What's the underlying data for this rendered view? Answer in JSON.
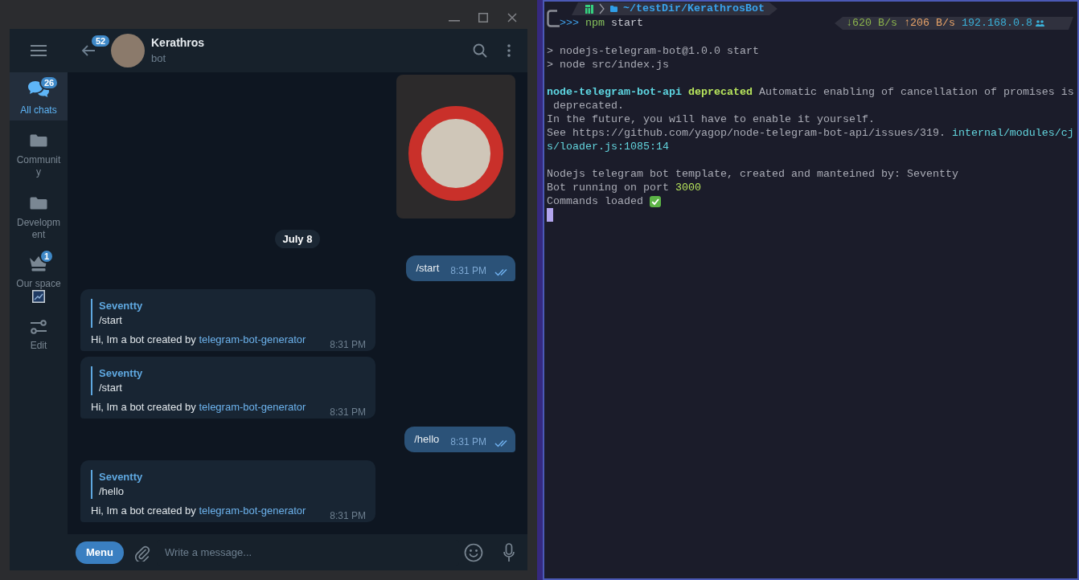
{
  "sidebar": {
    "items": [
      {
        "kind": "chats",
        "label": "All chats",
        "badge": "26",
        "selected": true
      },
      {
        "kind": "folder",
        "label": "Community",
        "selected": false
      },
      {
        "kind": "folder",
        "label": "Development",
        "selected": false
      },
      {
        "kind": "crown",
        "label": "Our space",
        "badge": "1",
        "selected": false
      },
      {
        "kind": "image",
        "selected": false
      },
      {
        "kind": "edit",
        "label": "Edit",
        "selected": false
      }
    ]
  },
  "header": {
    "title": "Kerathros",
    "subtitle": "bot",
    "unread_badge": "52"
  },
  "messages": [
    {
      "kind": "photo"
    },
    {
      "kind": "date",
      "text": "July 8"
    },
    {
      "kind": "outgoing",
      "text": "/start",
      "time": "8:31 PM",
      "read": true
    },
    {
      "kind": "incoming",
      "reply_author": "Seventty",
      "reply_text": "/start",
      "text": "Hi, Im a bot created by ",
      "link": "telegram-bot-generator",
      "time": "8:31 PM"
    },
    {
      "kind": "incoming",
      "reply_author": "Seventty",
      "reply_text": "/start",
      "text": "Hi, Im a bot created by ",
      "link": "telegram-bot-generator",
      "time": "8:31 PM"
    },
    {
      "kind": "outgoing",
      "text": "/hello",
      "time": "8:31 PM",
      "read": true
    },
    {
      "kind": "incoming",
      "reply_author": "Seventty",
      "reply_text": "/hello",
      "text": "Hi, Im a bot created by ",
      "link": "telegram-bot-generator",
      "time": "8:31 PM"
    }
  ],
  "composer": {
    "menu_button": "Menu",
    "placeholder": "Write a message..."
  },
  "terminal": {
    "prompt": {
      "path": "~/testDir/KerathrosBot",
      "arrows": ">>>",
      "command": "npm",
      "argument": "start"
    },
    "status": {
      "download": "↓620 B/s",
      "upload": "↑206 B/s",
      "ip": "192.168.0.8"
    },
    "output": [
      [
        [
          {
            "kind": "plain",
            "text": "> nodejs-telegram-bot@1.0.0 start"
          }
        ],
        [
          {
            "kind": "plain",
            "text": "> node src/index.js"
          }
        ]
      ],
      [
        [
          {
            "kind": "module",
            "text": "node-telegram-bot-api "
          },
          {
            "kind": "warning",
            "text": "deprecated"
          },
          {
            "kind": "plain",
            "text": " Automatic enabling of cancellation of promises is"
          }
        ],
        [
          {
            "kind": "plain",
            "text": " deprecated."
          }
        ],
        [
          {
            "kind": "plain",
            "text": "In the future, you will have to enable it yourself."
          }
        ],
        [
          {
            "kind": "plain",
            "text": "See https://github.com/yagop/node-telegram-bot-api/issues/319. "
          },
          {
            "kind": "path",
            "text": "internal/modules/cj"
          }
        ],
        [
          {
            "kind": "path",
            "text": "s/loader.js:1085:14"
          }
        ]
      ],
      [
        [
          {
            "kind": "plain",
            "text": "Nodejs telegram bot template, created and manteined by: Seventty"
          }
        ],
        [
          {
            "kind": "plain",
            "text": "Bot running on port "
          },
          {
            "kind": "number",
            "text": "3000"
          }
        ],
        [
          {
            "kind": "plain",
            "text": "Commands loaded"
          },
          {
            "kind": "check_emoji"
          }
        ]
      ]
    ],
    "cursor": true
  }
}
